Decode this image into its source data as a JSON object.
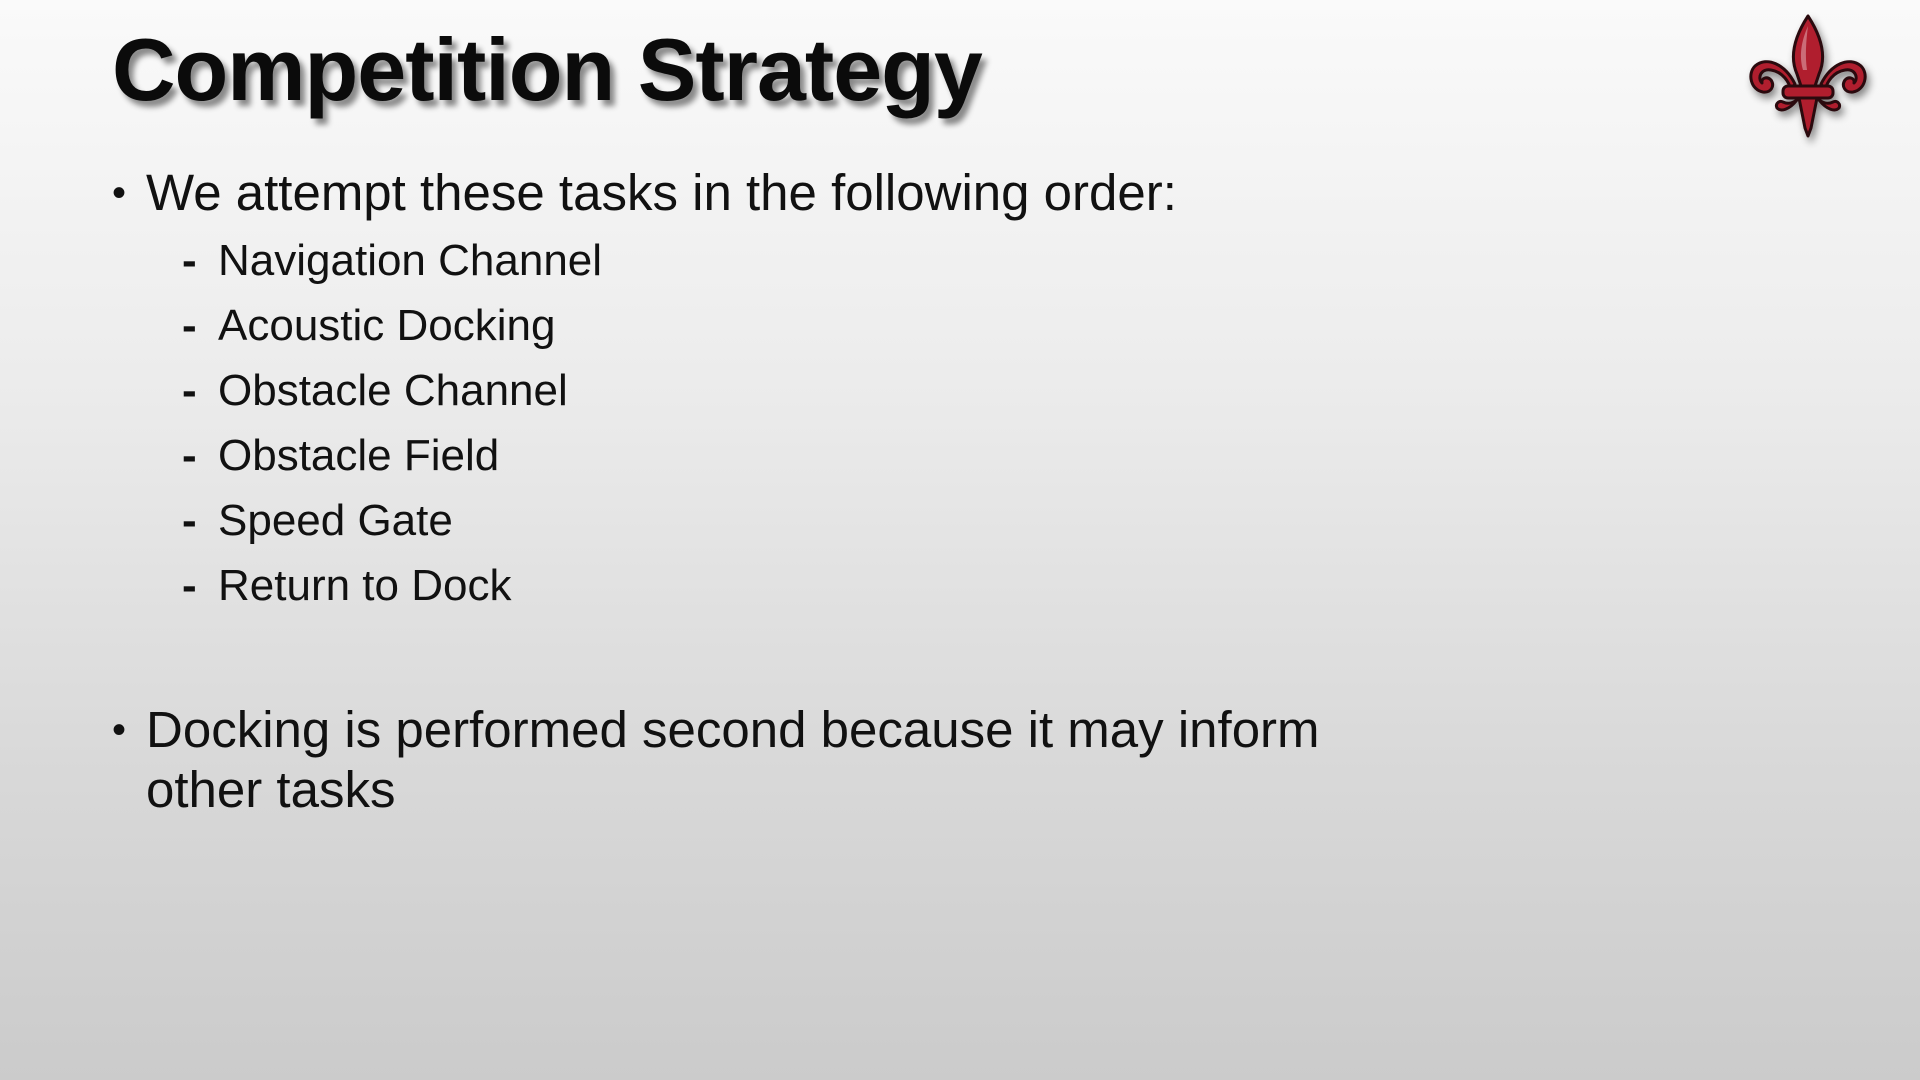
{
  "slide": {
    "title": "Competition Strategy",
    "logo_icon": "fleur-de-lis-icon",
    "colors": {
      "logo_red": "#b01e2e",
      "logo_outline": "#2a0a0e",
      "text": "#111111"
    },
    "bullets": [
      {
        "marker": "•",
        "text": "We attempt these tasks in the following order:",
        "sub_items": [
          {
            "marker": "-",
            "text": "Navigation Channel"
          },
          {
            "marker": "-",
            "text": "Acoustic Docking"
          },
          {
            "marker": "-",
            "text": "Obstacle Channel"
          },
          {
            "marker": "-",
            "text": "Obstacle Field"
          },
          {
            "marker": "-",
            "text": "Speed Gate"
          },
          {
            "marker": "-",
            "text": "Return to Dock"
          }
        ]
      },
      {
        "marker": "•",
        "text": "Docking is performed second because it may inform other tasks"
      }
    ]
  }
}
